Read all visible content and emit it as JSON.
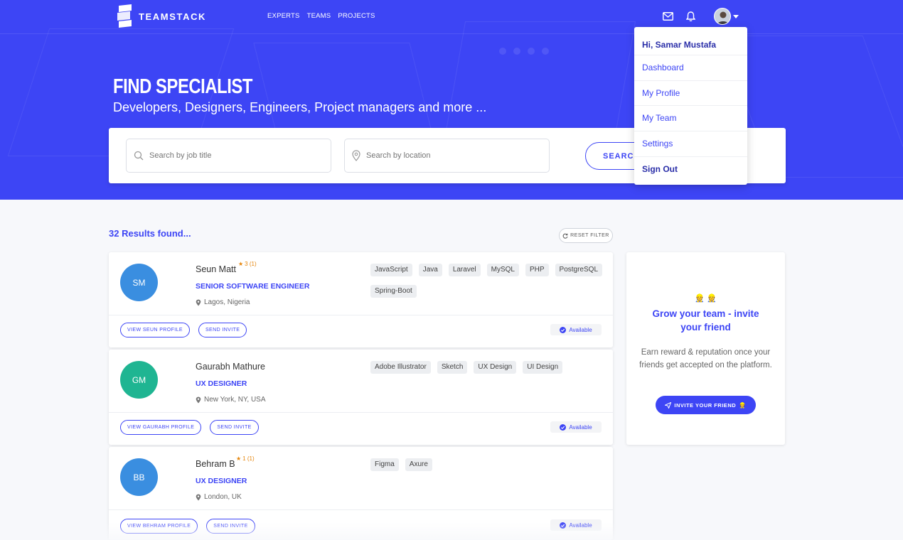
{
  "brand": {
    "name": "TEAMSTACK",
    "accent": "#3d45f5"
  },
  "nav": {
    "items": [
      "EXPERTS",
      "TEAMS",
      "PROJECTS"
    ]
  },
  "top_icons": [
    "mail-icon",
    "bell-icon"
  ],
  "hero": {
    "title": "FIND SPECIALIST",
    "subtitle": "Developers, Designers, Engineers, Project managers and more ..."
  },
  "search": {
    "job_placeholder": "Search by job title",
    "location_placeholder": "Search by location",
    "button": "SEARCH"
  },
  "user_menu": {
    "greeting": "Hi, Samar Mustafa",
    "items": [
      "Dashboard",
      "My Profile",
      "My Team",
      "Settings",
      "Sign Out"
    ]
  },
  "results": {
    "count_label": "32 Results found...",
    "reset_label": "RESET FILTER",
    "cards": [
      {
        "initials": "SM",
        "avatar_color": "#3a8ee0",
        "name": "Seun Matt",
        "rating": "3 (1)",
        "title": "SENIOR SOFTWARE ENGINEER",
        "location": "Lagos, Nigeria",
        "tags": [
          "JavaScript",
          "Java",
          "Laravel",
          "MySQL",
          "PHP",
          "PostgreSQL",
          "Spring-Boot"
        ],
        "view_label": "VIEW SEUN PROFILE",
        "invite_label": "SEND INVITE",
        "status": "Available"
      },
      {
        "initials": "GM",
        "avatar_color": "#1fb592",
        "name": "Gaurabh Mathure",
        "rating": "",
        "title": "UX DESIGNER",
        "location": "New York, NY, USA",
        "tags": [
          "Adobe Illustrator",
          "Sketch",
          "UX Design",
          "UI Design"
        ],
        "view_label": "VIEW GAURABH PROFILE",
        "invite_label": "SEND INVITE",
        "status": "Available"
      },
      {
        "initials": "BB",
        "avatar_color": "#3a8ee0",
        "name": "Behram B",
        "rating": "1 (1)",
        "title": "UX DESIGNER",
        "location": "London, UK",
        "tags": [
          "Figma",
          "Axure"
        ],
        "view_label": "VIEW BEHRAM PROFILE",
        "invite_label": "SEND INVITE",
        "status": "Available"
      }
    ]
  },
  "invite_card": {
    "emoji": "👷 👷",
    "title": "Grow your team - invite your friend",
    "text": "Earn reward & reputation once your friends get accepted on the platform.",
    "button": "INVITE YOUR FRIEND"
  }
}
